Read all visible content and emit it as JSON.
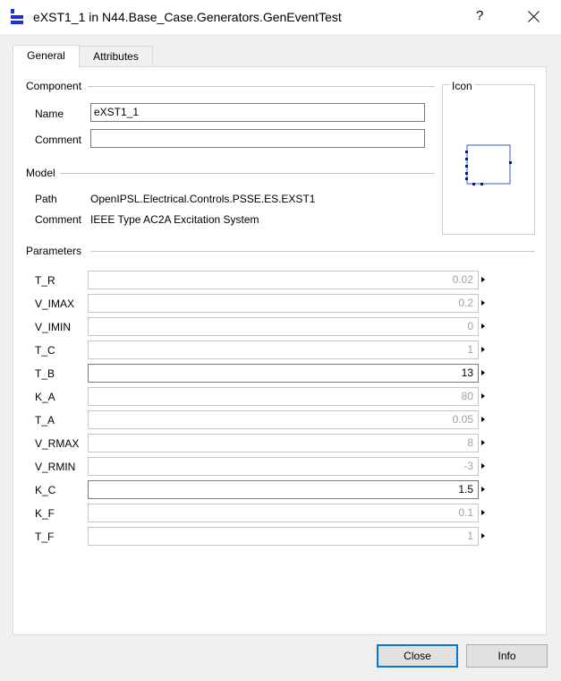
{
  "window": {
    "title": "eXST1_1 in N44.Base_Case.Generators.GenEventTest",
    "help_label": "?",
    "app_icon": "modelica-class-icon"
  },
  "tabs": [
    {
      "label": "General",
      "active": true
    },
    {
      "label": "Attributes",
      "active": false
    }
  ],
  "component": {
    "section_label": "Component",
    "name_label": "Name",
    "name_value": "eXST1_1",
    "comment_label": "Comment",
    "comment_value": ""
  },
  "model": {
    "section_label": "Model",
    "path_label": "Path",
    "path_value": "OpenIPSL.Electrical.Controls.PSSE.ES.EXST1",
    "comment_label": "Comment",
    "comment_value": "IEEE Type AC2A Excitation System"
  },
  "icon_section": {
    "label": "Icon",
    "border_color": "#2f5fbf"
  },
  "parameters": {
    "section_label": "Parameters",
    "rows": [
      {
        "name": "T_R",
        "value": "0.02",
        "modified": false
      },
      {
        "name": "V_IMAX",
        "value": "0.2",
        "modified": false
      },
      {
        "name": "V_IMIN",
        "value": "0",
        "modified": false
      },
      {
        "name": "T_C",
        "value": "1",
        "modified": false
      },
      {
        "name": "T_B",
        "value": "13",
        "modified": true
      },
      {
        "name": "K_A",
        "value": "80",
        "modified": false
      },
      {
        "name": "T_A",
        "value": "0.05",
        "modified": false
      },
      {
        "name": "V_RMAX",
        "value": "8",
        "modified": false
      },
      {
        "name": "V_RMIN",
        "value": "-3",
        "modified": false
      },
      {
        "name": "K_C",
        "value": "1.5",
        "modified": true
      },
      {
        "name": "K_F",
        "value": "0.1",
        "modified": false
      },
      {
        "name": "T_F",
        "value": "1",
        "modified": false
      }
    ]
  },
  "buttons": {
    "close_label": "Close",
    "info_label": "Info"
  },
  "colors": {
    "accent": "#0078d7",
    "app_icon_blue": "#1e2fd6",
    "default_value_text": "#a0a0a0"
  }
}
